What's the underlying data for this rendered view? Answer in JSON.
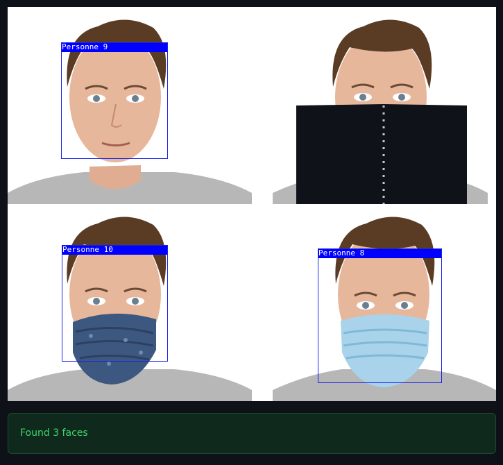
{
  "detections": [
    {
      "label": "Personne 9"
    },
    {
      "label": "Personne 10"
    },
    {
      "label": "Personne 8"
    }
  ],
  "status": {
    "message": "Found 3 faces"
  },
  "colors": {
    "page_background": "#0e1117",
    "box_color": "#0000ff",
    "status_background": "#0f2a1c",
    "status_text": "#3fd46d"
  },
  "icons": []
}
